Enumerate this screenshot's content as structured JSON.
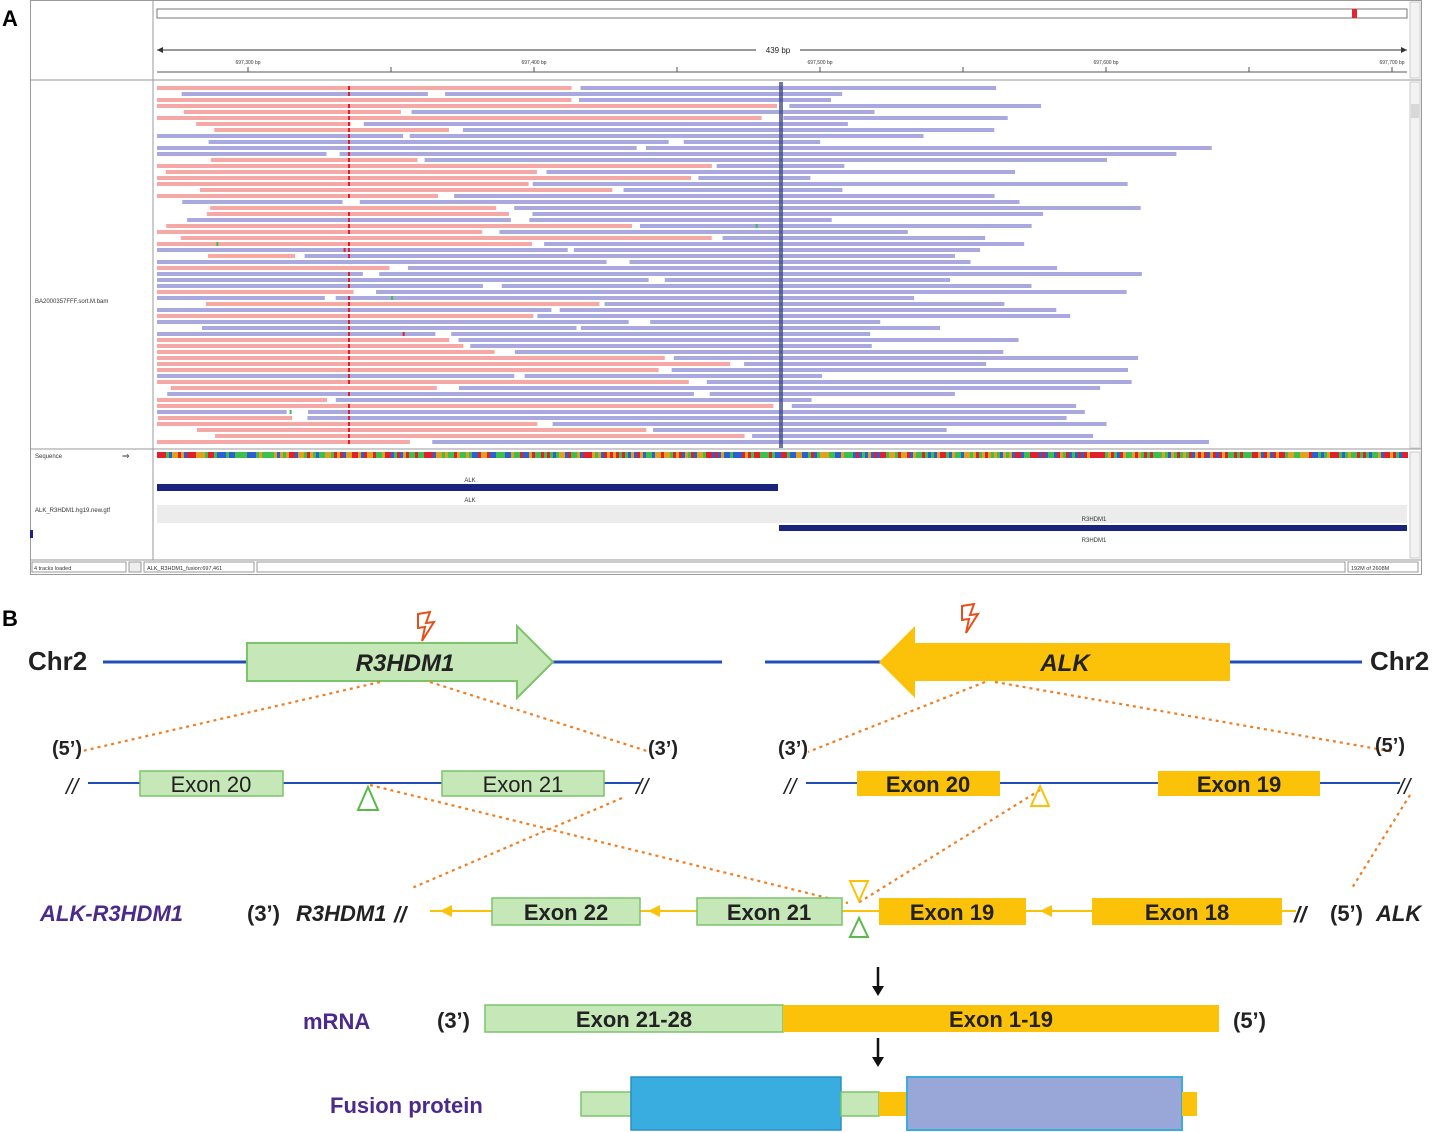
{
  "panels": {
    "a": "A",
    "b": "B"
  },
  "igv": {
    "ruler": {
      "span_label": "439 bp",
      "ticks": [
        "697,300 bp",
        "697,400 bp",
        "697,500 bp",
        "697,600 bp",
        "697,700 bp"
      ]
    },
    "alignment_track_name": "BA2000357FFF.sort.M.bam",
    "sequence_label": "Sequence",
    "sequence_arrow": "⇒",
    "gene_track_name": "ALK_R3HDM1.hg19.new.gtf",
    "genes": {
      "alk_label_top": "ALK",
      "alk_label_bottom": "ALK",
      "r3hdm1_label_top": "R3HDM1",
      "r3hdm1_label_bottom": "R3HDM1"
    },
    "status": {
      "tracks_loaded": "4 tracks loaded",
      "locus": "ALK_R3HDM1_fusion:697,461",
      "memory": "192M of 2608M"
    },
    "colors": {
      "forward_read": "#f5a8a5",
      "reverse_read": "#a9a9df",
      "gene": "#1a237e",
      "mismatch_red": "#e0202a",
      "mismatch_green": "#3cbf4c"
    }
  },
  "diagram": {
    "chr_left": "Chr2",
    "chr_right": "Chr2",
    "gene_left": "R3HDM1",
    "gene_right": "ALK",
    "left_exons": [
      "Exon 20",
      "Exon 21"
    ],
    "right_exons": [
      "Exon 20",
      "Exon 19"
    ],
    "left_ends": {
      "five": "(5’)",
      "three": "(3’)",
      "break": "//"
    },
    "right_ends": {
      "three": "(3’)",
      "five": "(5’)",
      "break": "//"
    },
    "fusion": {
      "name": "ALK-R3HDM1",
      "left_end": "(3’)",
      "left_gene": "R3HDM1",
      "left_break": "//",
      "exons": [
        "Exon 22",
        "Exon 21",
        "Exon 19",
        "Exon 18"
      ],
      "right_break": "//",
      "right_end": "(5’)",
      "right_gene": "ALK"
    },
    "mrna": {
      "label": "mRNA",
      "left_end": "(3’)",
      "right_end": "(5’)",
      "green_segment": "Exon 21-28",
      "orange_segment": "Exon 1-19"
    },
    "protein_label": "Fusion protein",
    "colors": {
      "green_fill": "#c6e7b8",
      "green_stroke": "#7cc36a",
      "orange": "#fbc209",
      "chrom_line": "#1f4fb6",
      "dotted": "#f07e22",
      "label_purple": "#4b2a8c",
      "protein_blue": "#39ace0",
      "protein_lavender": "#98a6d8"
    }
  }
}
